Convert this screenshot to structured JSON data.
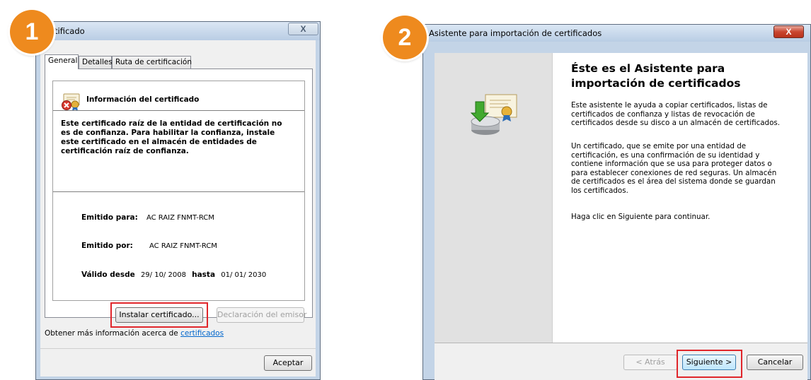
{
  "steps": {
    "step1": "1",
    "step2": "2"
  },
  "window1": {
    "title": "tificado",
    "close_label": "X",
    "tabs": [
      {
        "label": "General",
        "active": true
      },
      {
        "label": "Detalles",
        "active": false
      },
      {
        "label": "Ruta de certificación",
        "active": false
      }
    ],
    "info_heading": "Información del certificado",
    "warning": "Este certificado raíz de la entidad de certificación no es de confianza. Para habilitar la confianza, instale este certificado en el almacén de entidades de certificación raíz de confianza.",
    "issued_to_label": "Emitido para:",
    "issued_to": "AC RAIZ FNMT-RCM",
    "issued_by_label": "Emitido por:",
    "issued_by": "AC RAIZ FNMT-RCM",
    "valid_from_label": "Válido desde",
    "valid_from": "29/ 10/ 2008",
    "valid_to_label": "hasta",
    "valid_to": "01/ 01/ 2030",
    "install_button": "Instalar certificado...",
    "issuer_statement_button": "Declaración del emisor",
    "more_info_text": "Obtener más información acerca de ",
    "more_info_link": "certificados",
    "ok_button": "Aceptar"
  },
  "window2": {
    "title": "Asistente para importación de certificados",
    "close_label": "X",
    "heading": "Éste es el Asistente para importación de certificados",
    "paragraph1": "Este asistente le ayuda a copiar certificados, listas de certificados de confianza y listas de revocación de certificados desde su disco a un almacén de certificados.",
    "paragraph2": "Un certificado, que se emite por una entidad de certificación, es una confirmación de su identidad y contiene información que se usa para proteger datos o para establecer conexiones de red seguras. Un almacén de certificados es el área del sistema donde se guardan los certificados.",
    "paragraph3": "Haga clic en Siguiente para continuar.",
    "back_button": "< Atrás",
    "next_button": "Siguiente >",
    "cancel_button": "Cancelar"
  },
  "colors": {
    "badge": "#ee8a1e",
    "highlight": "#e0262b",
    "link": "#0066cc"
  },
  "icons": [
    "certificate-warning-icon",
    "certificate-import-icon"
  ]
}
